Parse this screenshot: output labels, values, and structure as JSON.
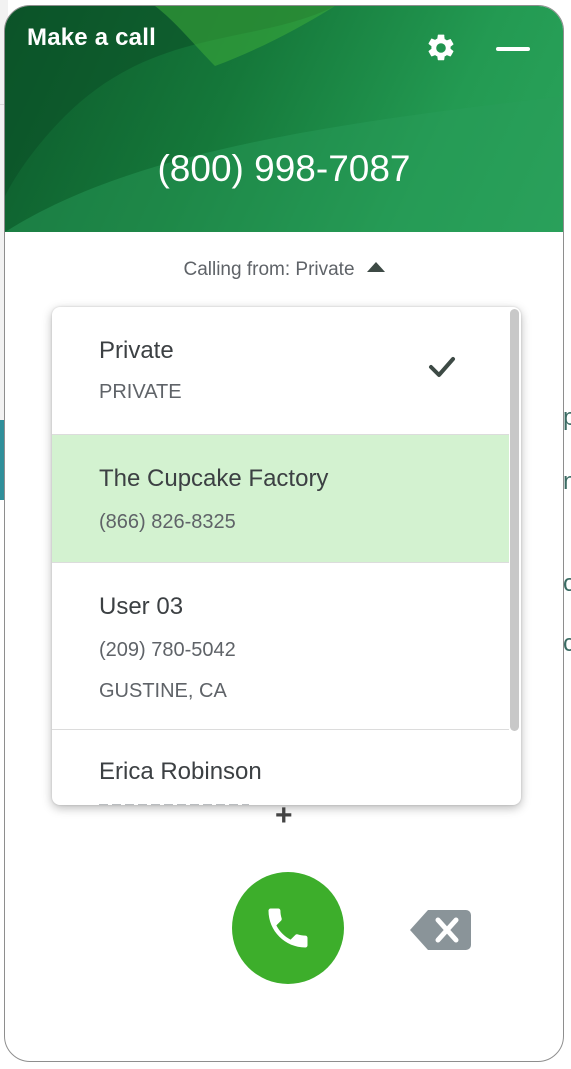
{
  "header": {
    "title": "Make a call",
    "settings_icon": "gear-icon",
    "minimize_icon": "minimize-icon",
    "dialed_number": "(800) 998-7087",
    "gradient_colors": [
      "#0d5a2c",
      "#15783a",
      "#2aa35b"
    ]
  },
  "calling_from": {
    "label": "Calling from: Private",
    "icon": "caret-up-icon"
  },
  "caller_ids": [
    {
      "name": "Private",
      "line1": "PRIVATE",
      "checked": true
    },
    {
      "name": "The Cupcake Factory",
      "line1": "(866) 826-8325",
      "highlighted": true
    },
    {
      "name": "User 03",
      "line1": "(209) 780-5042",
      "line2": "GUSTINE, CA"
    },
    {
      "name": "Erica Robinson"
    }
  ],
  "add_icon": "plus-icon",
  "call_button": {
    "icon": "phone-icon",
    "color": "#3dae2b"
  },
  "backspace_button": {
    "icon": "backspace-icon",
    "color": "#8a9499"
  },
  "colors": {
    "selected_row": "#d3f2d0",
    "text_primary": "#3c4043",
    "text_secondary": "#5f6368"
  }
}
